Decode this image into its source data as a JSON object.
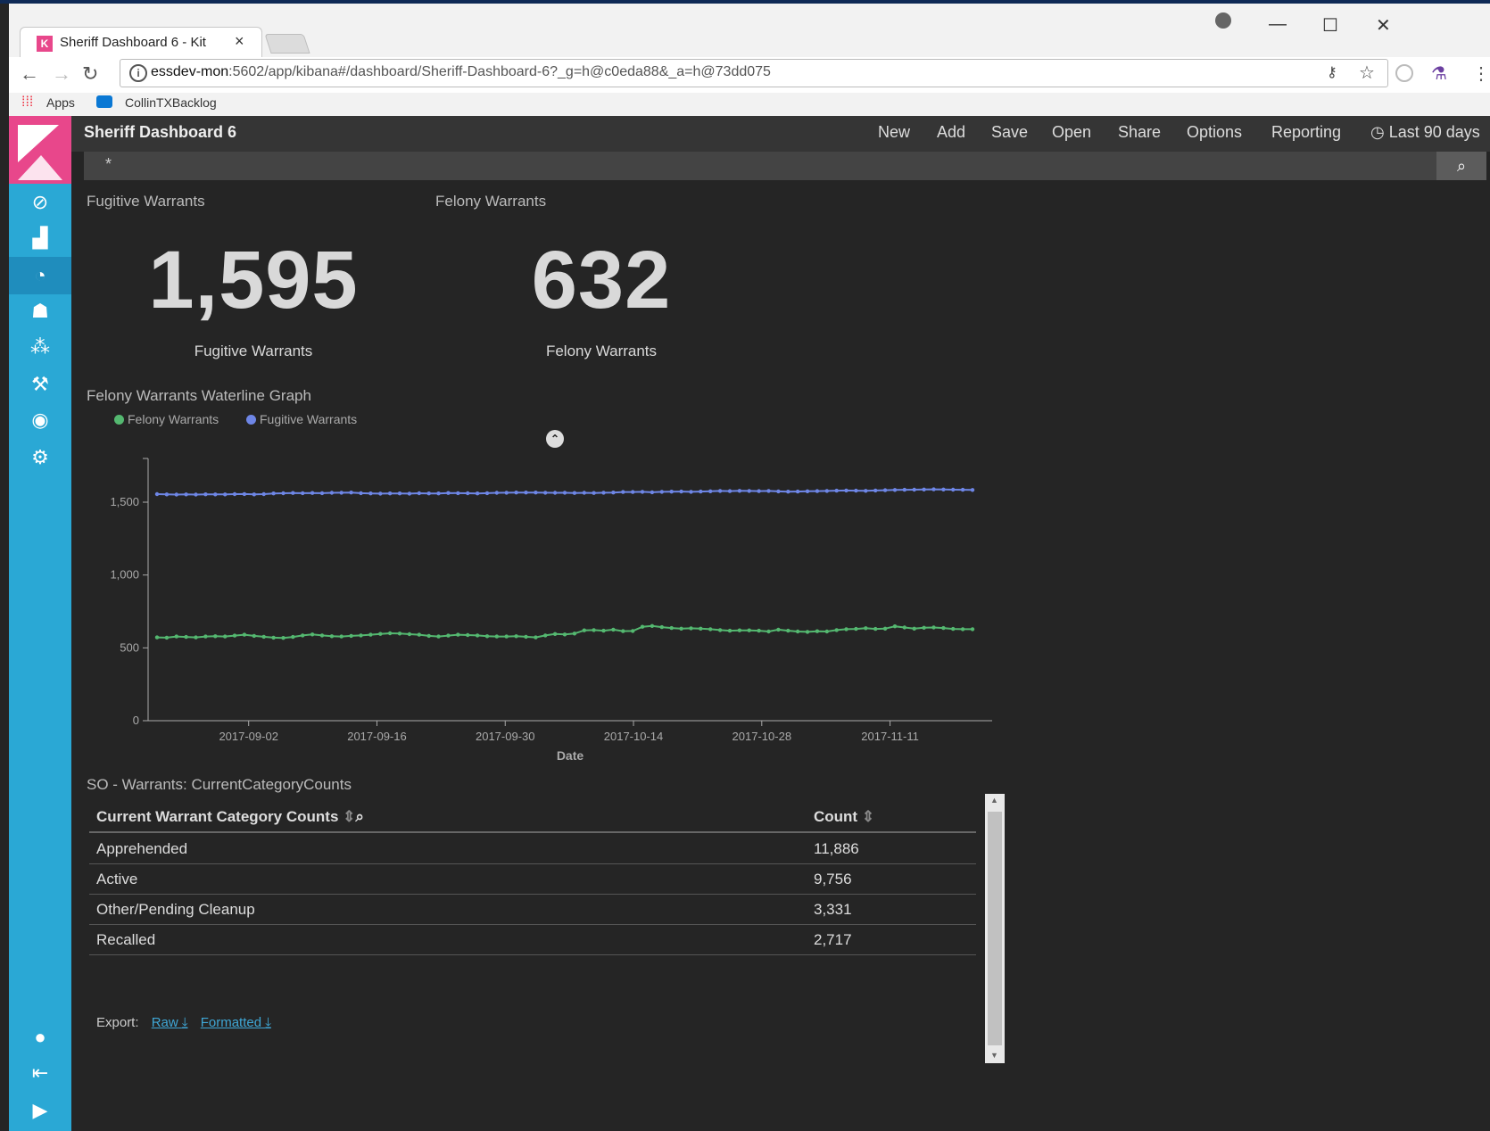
{
  "browser": {
    "tab_title": "Sheriff Dashboard 6 - Kit",
    "tab_close": "×",
    "favicon_letter": "K",
    "url_host": "essdev-mon",
    "url_path": ":5602/app/kibana#/dashboard/Sheriff-Dashboard-6?_g=h@c0eda88&_a=h@73dd075",
    "bookmarks": [
      {
        "label": "Apps",
        "icon": "apps-grid-icon"
      },
      {
        "label": "CollinTXBacklog",
        "icon": "azure-devops-icon"
      }
    ],
    "window_controls": {
      "minimize": "—",
      "maximize": "☐",
      "close": "✕"
    },
    "nav_icons": {
      "back": "←",
      "forward": "→",
      "reload": "↻"
    }
  },
  "kibana": {
    "dashboard_title": "Sheriff Dashboard 6",
    "menu": [
      "New",
      "Add",
      "Save",
      "Open",
      "Share",
      "Options",
      "Reporting"
    ],
    "time_range": "Last 90 days",
    "query": "*",
    "sidebar_icons": [
      "discover-icon",
      "visualize-icon",
      "dashboard-icon",
      "timelion-icon",
      "graph-icon",
      "dev-tools-icon",
      "monitoring-icon",
      "management-icon",
      "user-icon",
      "logout-icon",
      "collapse-icon"
    ]
  },
  "panels": {
    "fugitive": {
      "title": "Fugitive Warrants",
      "value": "1,595",
      "label": "Fugitive Warrants"
    },
    "felony": {
      "title": "Felony Warrants",
      "value": "632",
      "label": "Felony Warrants"
    },
    "graph": {
      "title": "Felony Warrants Waterline Graph"
    },
    "table": {
      "title": "SO - Warrants: CurrentCategoryCounts",
      "headers": [
        "Current Warrant Category Counts",
        "Count"
      ],
      "rows": [
        [
          "Apprehended",
          "11,886"
        ],
        [
          "Active",
          "9,756"
        ],
        [
          "Other/Pending Cleanup",
          "3,331"
        ],
        [
          "Recalled",
          "2,717"
        ]
      ],
      "export_label": "Export:",
      "export_raw": "Raw",
      "export_formatted": "Formatted"
    }
  },
  "chart_data": {
    "type": "line",
    "xlabel": "Date",
    "ylabel": "",
    "ylim": [
      0,
      1800
    ],
    "yticks": [
      0,
      500,
      1000,
      1500
    ],
    "ytick_labels": [
      "0",
      "500",
      "1,000",
      "1,500"
    ],
    "xticks": [
      "2017-09-02",
      "2017-09-16",
      "2017-09-30",
      "2017-10-14",
      "2017-10-28",
      "2017-11-11"
    ],
    "x_start": "2017-08-23",
    "x_end": "2017-11-20",
    "legend_position": "top-left",
    "series": [
      {
        "name": "Felony Warrants",
        "color": "#54b870",
        "values": [
          572,
          570,
          578,
          575,
          572,
          578,
          580,
          578,
          584,
          590,
          582,
          576,
          570,
          568,
          575,
          585,
          592,
          585,
          580,
          578,
          582,
          585,
          590,
          596,
          600,
          598,
          594,
          590,
          582,
          578,
          584,
          590,
          588,
          585,
          580,
          578,
          578,
          580,
          576,
          572,
          585,
          595,
          592,
          598,
          620,
          622,
          618,
          625,
          615,
          616,
          645,
          650,
          642,
          636,
          632,
          634,
          632,
          628,
          622,
          618,
          620,
          620,
          618,
          612,
          625,
          618,
          612,
          610,
          614,
          612,
          622,
          628,
          630,
          635,
          630,
          632,
          648,
          640,
          632,
          638,
          640,
          636,
          630,
          628,
          628
        ]
      },
      {
        "name": "Fugitive Warrants",
        "color": "#6e86e6",
        "values": [
          1555,
          1553,
          1552,
          1553,
          1552,
          1554,
          1553,
          1553,
          1555,
          1556,
          1553,
          1555,
          1560,
          1561,
          1563,
          1562,
          1563,
          1562,
          1564,
          1565,
          1566,
          1562,
          1560,
          1559,
          1560,
          1560,
          1559,
          1561,
          1560,
          1560,
          1563,
          1562,
          1561,
          1560,
          1562,
          1564,
          1565,
          1566,
          1566,
          1566,
          1565,
          1564,
          1565,
          1563,
          1564,
          1563,
          1565,
          1566,
          1570,
          1570,
          1571,
          1568,
          1571,
          1572,
          1573,
          1571,
          1573,
          1575,
          1577,
          1576,
          1578,
          1577,
          1576,
          1577,
          1574,
          1572,
          1573,
          1575,
          1576,
          1577,
          1579,
          1580,
          1579,
          1578,
          1580,
          1582,
          1584,
          1585,
          1586,
          1587,
          1588,
          1587,
          1586,
          1585,
          1584
        ]
      }
    ]
  }
}
